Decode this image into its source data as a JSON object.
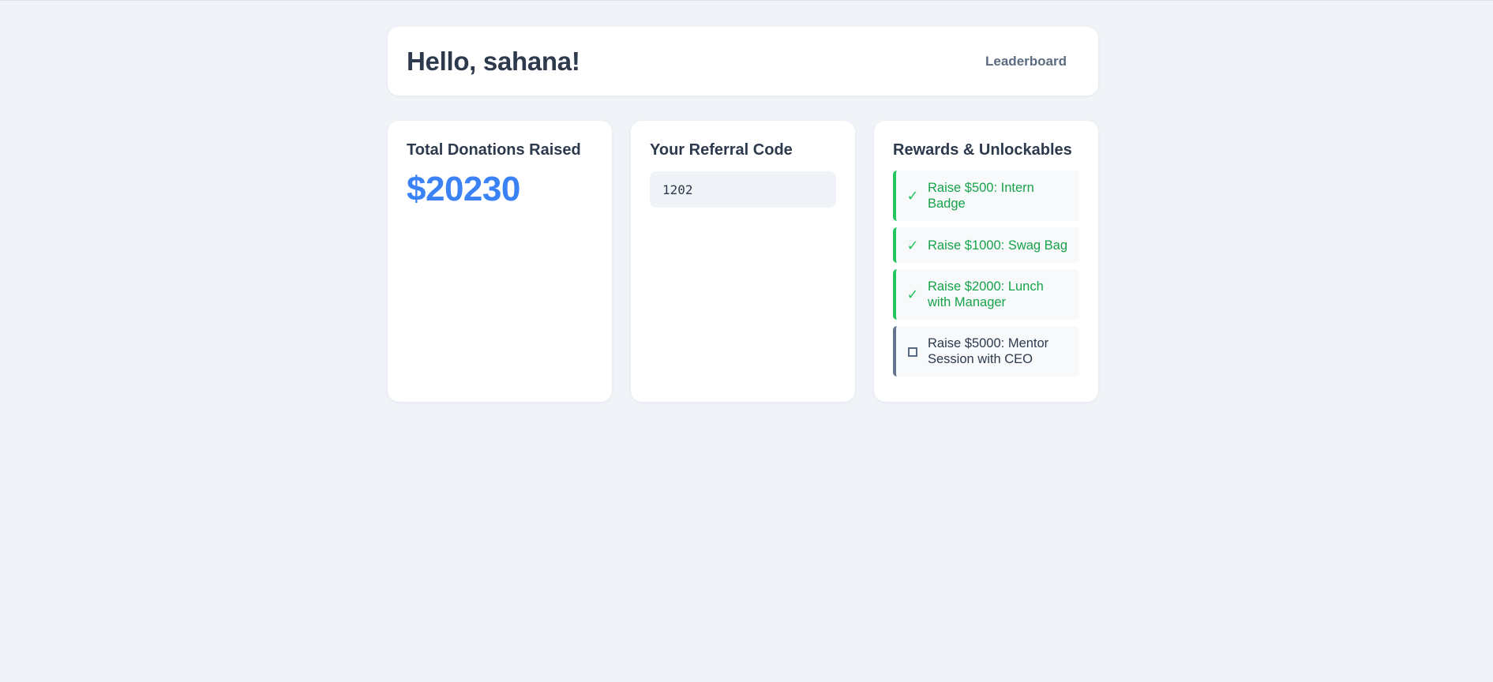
{
  "header": {
    "greeting": "Hello, sahana!",
    "leaderboard_label": "Leaderboard"
  },
  "donations": {
    "title": "Total Donations Raised",
    "amount": "$20230"
  },
  "referral": {
    "title": "Your Referral Code",
    "code": "1202"
  },
  "rewards": {
    "title": "Rewards & Unlockables",
    "items": [
      {
        "label": "Raise $500: Intern Badge",
        "unlocked": true,
        "icon": "check-icon"
      },
      {
        "label": "Raise $1000: Swag Bag",
        "unlocked": true,
        "icon": "check-icon"
      },
      {
        "label": "Raise $2000: Lunch with Manager",
        "unlocked": true,
        "icon": "check-icon"
      },
      {
        "label": "Raise $5000: Mentor Session with CEO",
        "unlocked": false,
        "icon": "empty-box-icon"
      }
    ]
  },
  "colors": {
    "background": "#f0f3f7",
    "accent_blue": "#3b82f6",
    "unlocked_green": "#22c55e",
    "locked_gray": "#64748b"
  }
}
